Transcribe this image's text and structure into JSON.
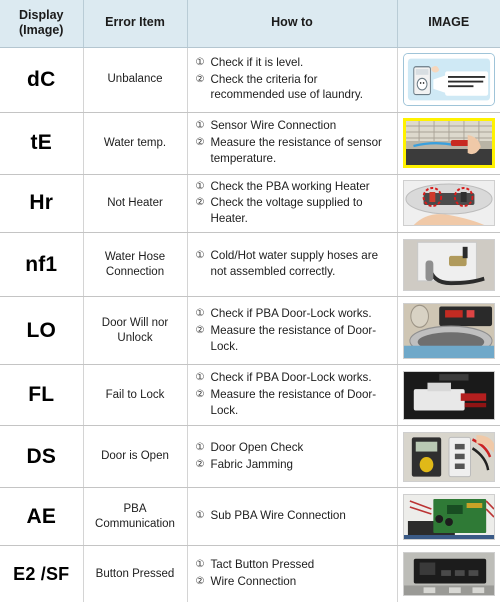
{
  "table": {
    "headers": {
      "display_line1": "Display",
      "display_line2": "(Image)",
      "error_item": "Error Item",
      "how_to": "How to",
      "image": "IMAGE"
    },
    "header_bg": "#dceaf1",
    "rows": [
      {
        "display": "dC",
        "error_item": "Unbalance",
        "steps": [
          {
            "num": "①",
            "text": "Check if it is level."
          },
          {
            "num": "②",
            "text": "Check the criteria for recommended use of laundry."
          }
        ],
        "image": {
          "name": "illustration-do-not-wash-waterproof-items",
          "type": "cartoon",
          "caption": "Do not wash or spin waterproof seats, mats or clothing",
          "border": "rounded-blue"
        }
      },
      {
        "display": "tE",
        "error_item": "Water temp.",
        "steps": [
          {
            "num": "①",
            "text": "Sensor Wire Connection"
          },
          {
            "num": "②",
            "text": "Measure the resistance of sensor temperature."
          }
        ],
        "image": {
          "name": "photo-sensor-wire-measurement",
          "type": "photo",
          "border": "yellow"
        }
      },
      {
        "display": "Hr",
        "error_item": "Not Heater",
        "steps": [
          {
            "num": "①",
            "text": "Check the PBA working Heater"
          },
          {
            "num": "②",
            "text": "Check the voltage supplied to Heater."
          }
        ],
        "image": {
          "name": "photo-heater-terminals-circled",
          "type": "photo",
          "border": "plain"
        }
      },
      {
        "display": "nf1",
        "error_item": "Water Hose Connection",
        "steps": [
          {
            "num": "①",
            "text": "Cold/Hot water supply hoses are not assembled correctly."
          }
        ],
        "image": {
          "name": "photo-water-supply-hose-tap",
          "type": "photo",
          "border": "plain"
        }
      },
      {
        "display": "LO",
        "error_item": "Door Will nor Unlock",
        "steps": [
          {
            "num": "①",
            "text": "Check if PBA Door-Lock works."
          },
          {
            "num": "②",
            "text": "Measure the resistance of Door-Lock."
          }
        ],
        "image": {
          "name": "photo-washer-door-control-panel",
          "type": "photo",
          "border": "plain"
        }
      },
      {
        "display": "FL",
        "error_item": "Fail to Lock",
        "steps": [
          {
            "num": "①",
            "text": "Check if PBA Door-Lock works."
          },
          {
            "num": "②",
            "text": "Measure the resistance of Door-Lock."
          }
        ],
        "image": {
          "name": "photo-door-lock-assembly",
          "type": "photo",
          "border": "plain"
        }
      },
      {
        "display": "DS",
        "error_item": "Door is Open",
        "steps": [
          {
            "num": "①",
            "text": "Door Open Check"
          },
          {
            "num": "②",
            "text": "Fabric Jamming"
          }
        ],
        "image": {
          "name": "photo-multimeter-door-switch-test",
          "type": "photo",
          "border": "plain"
        }
      },
      {
        "display": "AE",
        "error_item": "PBA Communication",
        "steps": [
          {
            "num": "①",
            "text": "Sub PBA Wire Connection"
          }
        ],
        "image": {
          "name": "photo-main-pba-circuit-board",
          "type": "photo",
          "border": "plain"
        }
      },
      {
        "display": "E2 /SF",
        "error_item": "Button Pressed",
        "steps": [
          {
            "num": "①",
            "text": "Tact Button Pressed"
          },
          {
            "num": "②",
            "text": "Wire Connection"
          }
        ],
        "image": {
          "name": "photo-control-panel-buttons",
          "type": "photo",
          "border": "plain"
        }
      }
    ]
  }
}
